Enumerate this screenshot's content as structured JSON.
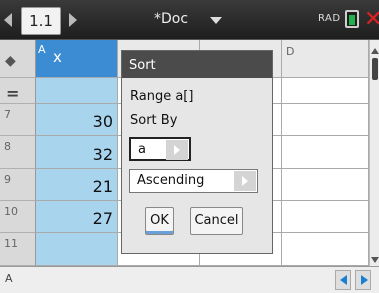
{
  "titlebar": {
    "page": "1.1",
    "document": "*Doc",
    "angle_mode": "RAD",
    "icons": [
      "nav-left-icon",
      "nav-right-icon",
      "doc-menu-icon",
      "battery-icon",
      "close-icon"
    ]
  },
  "sheet": {
    "columns": [
      {
        "letter": "A",
        "name": "x"
      },
      {
        "letter": "D",
        "name": ""
      }
    ],
    "rows": [
      {
        "num": "7",
        "a": "30"
      },
      {
        "num": "8",
        "a": "32"
      },
      {
        "num": "9",
        "a": "21"
      },
      {
        "num": "10",
        "a": "27"
      },
      {
        "num": "11",
        "a": ""
      }
    ],
    "formula_row_symbol": "=",
    "status_cell": "A"
  },
  "dialog": {
    "title": "Sort",
    "range_label": "Range a[]",
    "sort_by_label": "Sort By",
    "sort_by_value": "a",
    "order_value": "Ascending",
    "ok_label": "OK",
    "cancel_label": "Cancel"
  },
  "colors": {
    "column_header": "#3b8cd2",
    "column_fill": "#a9d4ee",
    "dialog_title": "#4b4b4b",
    "close": "#e02020",
    "battery": "#22b14c"
  }
}
